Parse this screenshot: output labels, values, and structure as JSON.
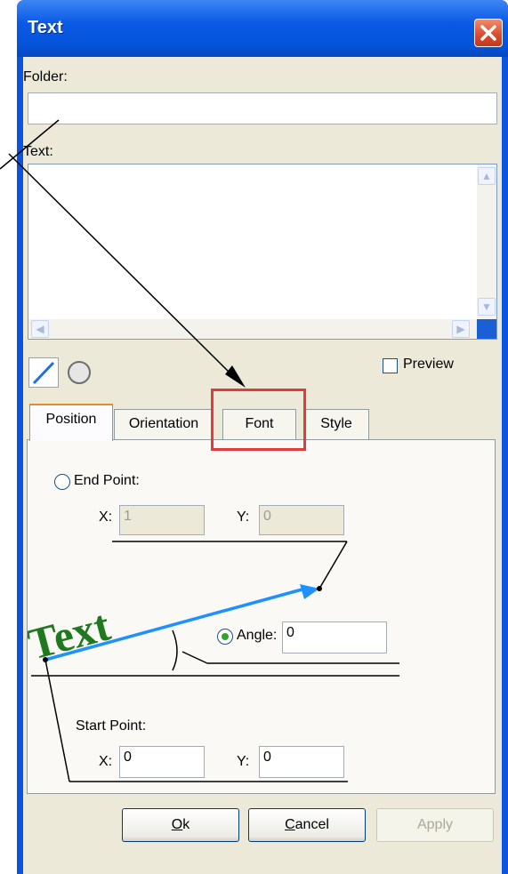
{
  "window": {
    "title": "Text"
  },
  "folder": {
    "label": "Folder:",
    "value": ""
  },
  "text": {
    "label": "Text:",
    "value": ""
  },
  "preview": {
    "label": "Preview",
    "checked": false
  },
  "tabs": [
    {
      "label": "Position",
      "active": true
    },
    {
      "label": "Orientation",
      "active": false
    },
    {
      "label": "Font",
      "active": false
    },
    {
      "label": "Style",
      "active": false
    }
  ],
  "position": {
    "end_point": {
      "label": "End Point:",
      "selected": false,
      "x_label": "X:",
      "x_value": "1",
      "y_label": "Y:",
      "y_value": "0"
    },
    "angle": {
      "label": "Angle:",
      "selected": true,
      "value": "0"
    },
    "start_point": {
      "label": "Start Point:",
      "x_label": "X:",
      "x_value": "0",
      "y_label": "Y:",
      "y_value": "0"
    },
    "diagram_text": "Text"
  },
  "buttons": {
    "ok": "Ok",
    "ok_mnemonic": "O",
    "ok_rest": "k",
    "cancel_mnemonic": "C",
    "cancel_rest": "ancel",
    "cancel": "Cancel",
    "apply": "Apply"
  },
  "colors": {
    "titlebar": "#0a54e0",
    "highlight": "#e23b3b",
    "diagram_text": "#1f7a1f",
    "diagram_line": "#1e90ff"
  }
}
